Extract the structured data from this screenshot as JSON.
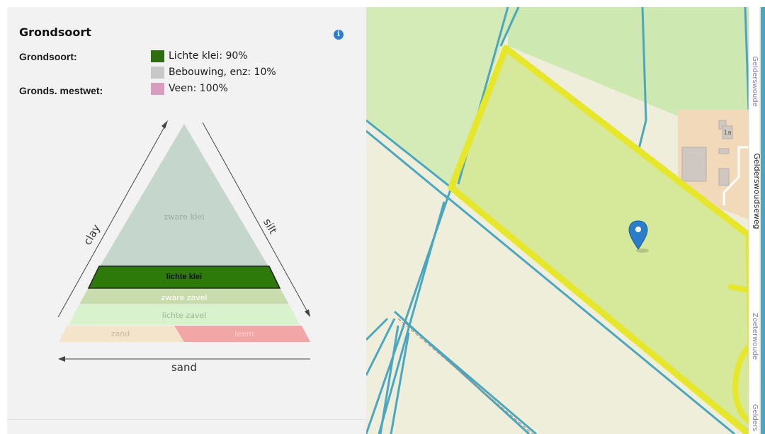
{
  "panel": {
    "title": "Grondsoort",
    "info_icon": "info-icon",
    "rows": [
      {
        "label": "Grondsoort:"
      },
      {
        "label": "Gronds. mestwet:"
      }
    ],
    "legend": [
      {
        "text": "Lichte klei: 90%",
        "color": "#2e6e10"
      },
      {
        "text": "Bebouwing, enz: 10%",
        "color": "#c8c8c8"
      },
      {
        "text": "Veen: 100%",
        "color": "#d79cbf"
      }
    ]
  },
  "triangle": {
    "axis_left": "clay",
    "axis_right": "silt",
    "axis_bottom": "sand",
    "zones": {
      "zware_klei": "zware klei",
      "lichte_klei": "lichte klei",
      "zware_zavel": "zware zavel",
      "lichte_zavel": "lichte zavel",
      "zand": "zand",
      "leem": "leem"
    },
    "colors": {
      "zware_klei": "#c5d6cc",
      "lichte_klei": "#2d7a0b",
      "zware_zavel": "#c9dcae",
      "lichte_zavel": "#d7f2cd",
      "zand": "#f4e4cb",
      "leem": "#f2a6a6"
    }
  },
  "map": {
    "marker_icon": "map-pin-icon",
    "roads": {
      "gelderswoude": "Gelderswoude",
      "gelderswoudseweg": "Gelderswoudseweg",
      "zoeterwoude": "Zoeterwoude",
      "gelders": "Gelders"
    },
    "house_number": "1a",
    "colors": {
      "field": "#d6e89a",
      "boundary": "#e6e62a",
      "water": "#4aa7bf",
      "meadow": "#cde8b0"
    }
  }
}
